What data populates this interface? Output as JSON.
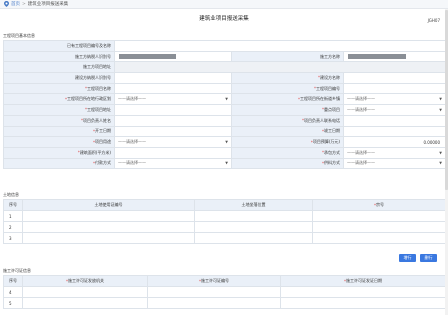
{
  "breadcrumb": {
    "home": "首页",
    "separator": ">",
    "current": "建筑业项目报送采集"
  },
  "document": {
    "title": "建筑业项目报送采集",
    "code": "JGH07"
  },
  "basic_section": {
    "title": "工程项目基本信息",
    "rows": [
      [
        {
          "label": "已有工程项目编号及名称",
          "value": "",
          "kind": "text"
        }
      ],
      [
        {
          "label": "施工方纳税人识别号",
          "value": "",
          "kind": "masked"
        },
        {
          "label": "施工方名称",
          "value": "",
          "kind": "masked"
        }
      ],
      [
        {
          "label": "施工方项目地址",
          "value": "",
          "kind": "gray"
        }
      ],
      [
        {
          "label": "建设方纳税人识别号",
          "value": "",
          "kind": "text"
        },
        {
          "label": "*建设方名称",
          "value": "",
          "kind": "text"
        }
      ],
      [
        {
          "label": "*工程项目名称",
          "value": "",
          "kind": "text"
        },
        {
          "label": "*工程项目编号",
          "value": "",
          "kind": "text"
        }
      ],
      [
        {
          "label": "*工程项目所在地行政区划",
          "value": "——请选择——",
          "kind": "select"
        },
        {
          "label": "*工程项目所在街道乡镇",
          "value": "——请选择——",
          "kind": "select"
        }
      ],
      [
        {
          "label": "*工程项目地址",
          "value": "",
          "kind": "text"
        },
        {
          "label": "*重点项目",
          "value": "——请选择——",
          "kind": "select"
        }
      ],
      [
        {
          "label": "*项目负责人姓名",
          "value": "",
          "kind": "text"
        },
        {
          "label": "*项目负责人联系电话",
          "value": "",
          "kind": "text"
        }
      ],
      [
        {
          "label": "*开工日期",
          "value": "",
          "kind": "text"
        },
        {
          "label": "*竣工日期",
          "value": "",
          "kind": "text"
        }
      ],
      [
        {
          "label": "*项目用途",
          "value": "——请选择——",
          "kind": "select"
        },
        {
          "label": "*项目预算(万元)",
          "value": "0.00000",
          "kind": "number"
        }
      ],
      [
        {
          "label": "*建筑面积(平方米)",
          "value": "",
          "kind": "text"
        },
        {
          "label": "*承包方式",
          "value": "——请选择——",
          "kind": "select"
        }
      ],
      [
        {
          "label": "*付款方式",
          "value": "——请选择——",
          "kind": "select"
        },
        {
          "label": "*供料方式",
          "value": "——请选择——",
          "kind": "select"
        }
      ]
    ]
  },
  "land_section": {
    "title": "土地信息",
    "headers": [
      "序号",
      "土地使用证编号",
      "土地坐落位置",
      "*宗号"
    ],
    "rows": [
      [
        "1",
        "",
        "",
        ""
      ],
      [
        "2",
        "",
        "",
        ""
      ],
      [
        "3",
        "",
        "",
        ""
      ]
    ],
    "buttons": {
      "add": "增行",
      "delete": "删行"
    }
  },
  "permit_section": {
    "title": "施工许可证信息",
    "headers": [
      "序号",
      "*施工许可证发放机关",
      "*施工许可证编号",
      "*施工许可证发证日期"
    ],
    "rows": [
      [
        "4",
        "",
        "",
        ""
      ],
      [
        "5",
        "",
        "",
        ""
      ]
    ]
  },
  "colors": {
    "label_bg": "#eaf0f8",
    "border": "#dde3ea",
    "accent": "#3a78e0",
    "required": "#e04848"
  }
}
